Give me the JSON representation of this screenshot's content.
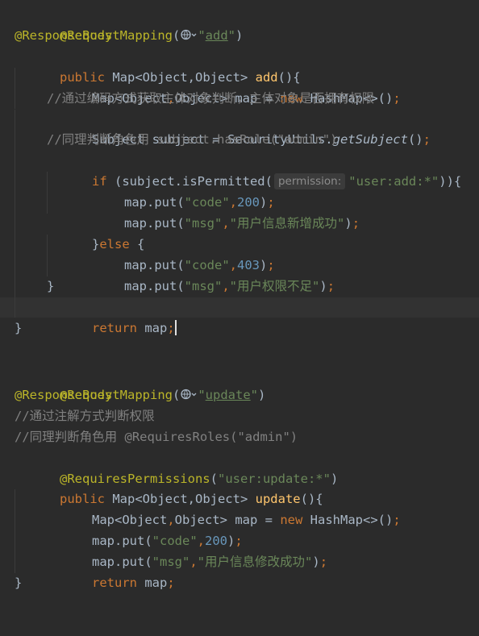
{
  "editor": {
    "block1": {
      "ann_request": "@RequestMapping",
      "paren_open": "(",
      "quote": "\"",
      "path": "add",
      "close_req": "\")",
      "ann_response": "@ResponseBody",
      "sig_public": "public",
      "sig_type": " Map<Object,Object> ",
      "sig_name": "add",
      "sig_end": "(){",
      "decl_type": "Map<Object",
      "decl_comma": ",",
      "decl_rest": "Object> map = ",
      "decl_new": "new",
      "decl_ctor": " HashMap<>()",
      "semi": ";",
      "comment1": "//通过编码方式获取主体对象判断，主体对象是否拥有权限",
      "subject_decl": "Subject subject = SecurityUtils.",
      "get_subject": "getSubject",
      "call_end": "()",
      "comment2": "//同理判断角色用 subject.hasRole(\"admin\")",
      "if_kw": "if",
      "if_call": " (subject.isPermitted(",
      "hint_param": "permission:",
      "perm_str": "\"user:add:*\"",
      "if_end": ")){",
      "put1_start": "map.put(",
      "code_key": "\"code\"",
      "comma": ",",
      "code_ok": "200",
      "put_end": ")",
      "msg_key": "\"msg\"",
      "msg_add_ok": "\"用户信息新增成功\"",
      "brace_close": "}",
      "else_kw": "else",
      "else_open": " {",
      "code_deny": "403",
      "msg_deny": "\"用户权限不足\"",
      "return_kw": "return",
      "return_val": " map",
      "method_close": "}"
    },
    "block2": {
      "ann_request": "@RequestMapping",
      "path": "update",
      "ann_response": "@ResponseBody",
      "comment1": "//通过注解方式判断权限",
      "comment2": "//同理判断角色用 @RequiresRoles(\"admin\")",
      "ann_perm": "@RequiresPermissions",
      "perm_str": "\"user:update:*\"",
      "sig_name": "update",
      "msg_update_ok": "\"用户信息修改成功\""
    }
  }
}
